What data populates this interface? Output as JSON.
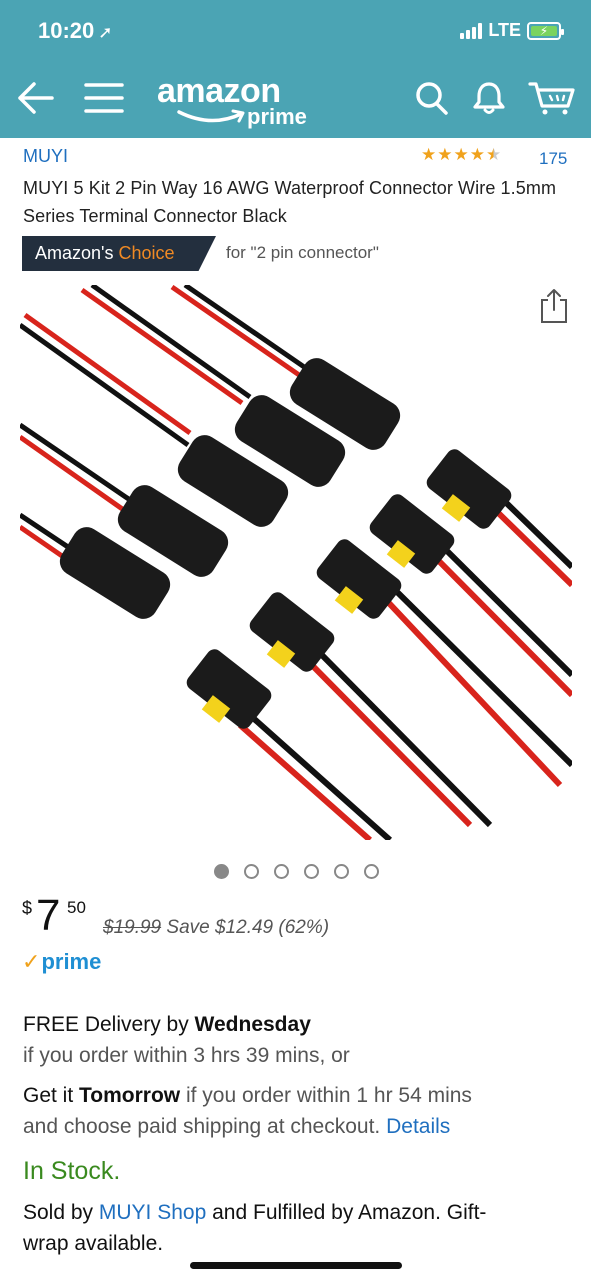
{
  "status_bar": {
    "time": "10:20",
    "network": "LTE"
  },
  "header": {
    "logo_text": "amazon",
    "logo_sub": "prime"
  },
  "product": {
    "brand": "MUYI",
    "rating_stars": 4.5,
    "rating_count": "175",
    "title": "MUYI 5 Kit 2 Pin Way 16 AWG Waterproof Connector Wire 1.5mm Series Terminal Connector Black",
    "choice_label_1": "Amazon's",
    "choice_label_2": "Choice",
    "choice_for": "for \"2 pin connector\""
  },
  "carousel": {
    "count": 6,
    "active": 0
  },
  "price": {
    "currency": "$",
    "whole": "7",
    "fraction": "50",
    "list_price": "$19.99",
    "savings": "Save $12.49 (62%)",
    "prime_label": "prime"
  },
  "delivery": {
    "free_prefix": "FREE Delivery by ",
    "free_day": "Wednesday",
    "free_condition": "if you order within 3 hrs 39 mins, or",
    "fast_prefix": "Get it ",
    "fast_day": "Tomorrow",
    "fast_condition": " if you order within 1 hr 54 mins",
    "fast_line2": "and choose paid shipping at checkout. ",
    "details_link": "Details"
  },
  "stock": {
    "status": "In Stock.",
    "sold_by_prefix": "Sold by ",
    "seller": "MUYI Shop",
    "sold_by_suffix": " and Fulfilled by Amazon. Gift-",
    "sold_by_line2": "wrap available."
  },
  "colors": {
    "header_bg": "#4ba4b4",
    "link": "#1f6fbf",
    "star": "#f0a21c",
    "in_stock": "#3a8a1f",
    "choice_bg": "#232f3e",
    "choice_accent": "#f08a24"
  }
}
